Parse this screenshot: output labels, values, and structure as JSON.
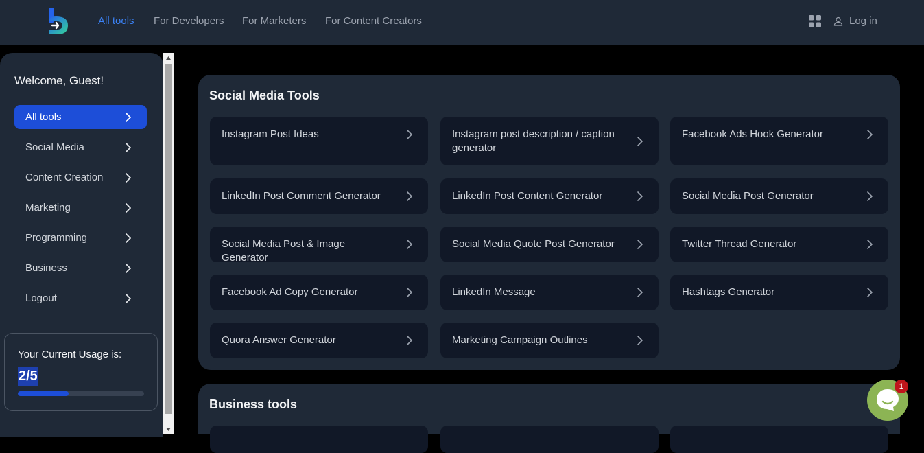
{
  "colors": {
    "accent": "#3b82f6",
    "active_bg": "#1d4ed8",
    "panel": "#1f2937",
    "card": "#111827",
    "chat": "#8cb454",
    "badge": "#c0161b"
  },
  "nav": {
    "links": [
      {
        "label": "All tools",
        "active": true
      },
      {
        "label": "For Developers"
      },
      {
        "label": "For Marketers"
      },
      {
        "label": "For Content Creators"
      }
    ],
    "apps_icon": "grid-icon",
    "login_label": "Log in",
    "login_icon": "user-icon"
  },
  "sidebar": {
    "welcome": "Welcome, Guest!",
    "items": [
      {
        "label": "All tools",
        "active": true
      },
      {
        "label": "Social Media"
      },
      {
        "label": "Content Creation"
      },
      {
        "label": "Marketing"
      },
      {
        "label": "Programming"
      },
      {
        "label": "Business"
      },
      {
        "label": "Logout"
      }
    ],
    "usage": {
      "label": "Your Current Usage is:",
      "value": "2/5",
      "progress": 0.4
    }
  },
  "sections": [
    {
      "title": "Social Media Tools",
      "cards": [
        "Instagram Post Ideas",
        "Instagram post description / caption generator",
        "Facebook Ads Hook Generator",
        "LinkedIn Post Comment Generator",
        "LinkedIn Post Content Generator",
        "Social Media Post Generator",
        "Social Media Post & Image Generator",
        "Social Media Quote Post Generator",
        "Twitter Thread Generator",
        "Facebook Ad Copy Generator",
        "LinkedIn Message",
        "Hashtags Generator",
        "Quora Answer Generator",
        "Marketing Campaign Outlines"
      ]
    },
    {
      "title": "Business tools",
      "cards": []
    }
  ],
  "chat": {
    "badge_count": "1",
    "icon": "chat-icon"
  }
}
